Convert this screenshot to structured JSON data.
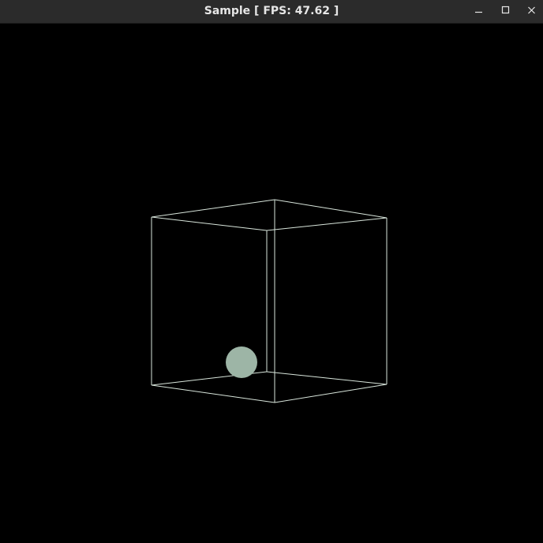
{
  "window": {
    "title": "Sample [ FPS: 47.62 ]"
  },
  "controls": {
    "minimize_icon": "minimize-icon",
    "maximize_icon": "maximize-icon",
    "close_icon": "close-icon"
  },
  "scene": {
    "background_color": "#000000",
    "wireframe_color": "#d9e6dc",
    "ball_color": "#9db5a6",
    "titlebar_color": "#2b2b2b",
    "title_color": "#e6e6e6"
  }
}
